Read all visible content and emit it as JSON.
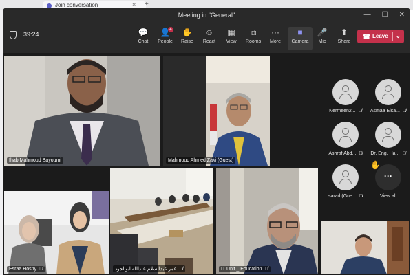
{
  "browser": {
    "tab_title": "Join conversation",
    "close_glyph": "×",
    "new_tab_glyph": "+"
  },
  "window": {
    "title": "Meeting in \"General\"",
    "controls": [
      "—",
      "☐",
      "✕"
    ]
  },
  "toolbar": {
    "timer": "39:24",
    "buttons": [
      {
        "label": "Chat",
        "icon": "chat-icon",
        "glyph": "💬"
      },
      {
        "label": "People",
        "icon": "people-icon",
        "glyph": "👤",
        "badge": "4"
      },
      {
        "label": "Raise",
        "icon": "hand-icon",
        "glyph": "✋"
      },
      {
        "label": "React",
        "icon": "smiley-icon",
        "glyph": "☺"
      },
      {
        "label": "View",
        "icon": "grid-icon",
        "glyph": "▦"
      },
      {
        "label": "Rooms",
        "icon": "rooms-icon",
        "glyph": "⧉"
      },
      {
        "label": "More",
        "icon": "more-icon",
        "glyph": "···"
      },
      {
        "label": "Camera",
        "icon": "camera-icon",
        "glyph": "■"
      },
      {
        "label": "Mic",
        "icon": "mic-icon",
        "glyph": "🎤"
      },
      {
        "label": "Share",
        "icon": "share-icon",
        "glyph": "⬆"
      }
    ],
    "leave_label": "Leave"
  },
  "participants": {
    "tiles": [
      {
        "name": "Ihab Mahmoud Bayoumi",
        "muted": false
      },
      {
        "name": "Mahmoud Ahmed Zaki (Guest)",
        "muted": false
      },
      {
        "name": "Esraa Hosny",
        "muted": true
      },
      {
        "name": "عمر عبدالسلام عبدالله ابوالجود",
        "muted": true
      },
      {
        "name": "IT Unit _ Education",
        "muted": true
      },
      {
        "name": "",
        "muted": false
      }
    ],
    "roster": [
      {
        "name": "Nermeen2...",
        "muted": true
      },
      {
        "name": "Asmaa Elsa...",
        "muted": true
      },
      {
        "name": "Ashraf Abd...",
        "muted": true
      },
      {
        "name": "Dr. Eng. Ha...",
        "muted": true
      },
      {
        "name": "sarad (Gue...",
        "muted": true
      }
    ],
    "view_all_label": "View all",
    "mic_off_glyph": "🎙̸"
  },
  "colors": {
    "accent": "#5b5fc7",
    "leave": "#c4314b",
    "background": "#1f1f1f"
  }
}
